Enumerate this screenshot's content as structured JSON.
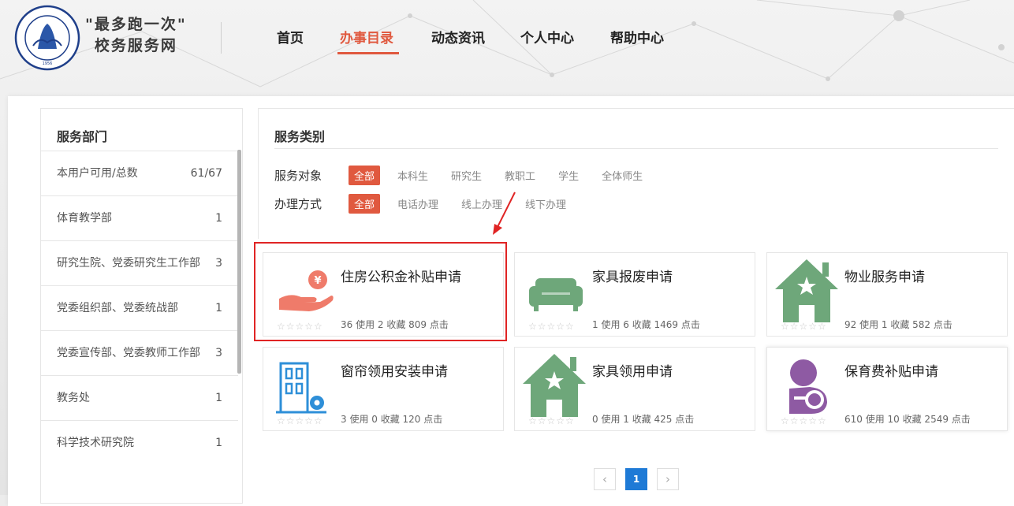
{
  "header": {
    "title_line1": "\"最多跑一次\"",
    "title_line2": "校务服务网",
    "nav": [
      {
        "label": "首页",
        "active": false
      },
      {
        "label": "办事目录",
        "active": true
      },
      {
        "label": "动态资讯",
        "active": false
      },
      {
        "label": "个人中心",
        "active": false
      },
      {
        "label": "帮助中心",
        "active": false
      }
    ]
  },
  "sidebar": {
    "title": "服务部门",
    "items": [
      {
        "label": "本用户可用/总数",
        "count": "61/67"
      },
      {
        "label": "体育教学部",
        "count": "1"
      },
      {
        "label": "研究生院、党委研究生工作部",
        "count": "3"
      },
      {
        "label": "党委组织部、党委统战部",
        "count": "1"
      },
      {
        "label": "党委宣传部、党委教师工作部",
        "count": "3"
      },
      {
        "label": "教务处",
        "count": "1"
      },
      {
        "label": "科学技术研究院",
        "count": "1"
      }
    ]
  },
  "content": {
    "title": "服务类别",
    "filters": {
      "audience_label": "服务对象",
      "audience_options": [
        "全部",
        "本科生",
        "研究生",
        "教职工",
        "学生",
        "全体师生"
      ],
      "method_label": "办理方式",
      "method_options": [
        "全部",
        "电话办理",
        "线上办理",
        "线下办理"
      ]
    },
    "cards": [
      {
        "name": "住房公积金补贴申请",
        "stats": "36 使用 2 收藏 809 点击",
        "icon": "hand-money-icon",
        "color": "#ef7b6a"
      },
      {
        "name": "家具报废申请",
        "stats": "1 使用 6 收藏 1469 点击",
        "icon": "sofa-icon",
        "color": "#6ea77a"
      },
      {
        "name": "物业服务申请",
        "stats": "92 使用 1 收藏 582 点击",
        "icon": "house-star-icon",
        "color": "#6ea77a"
      },
      {
        "name": "窗帘领用安装申请",
        "stats": "3 使用 0 收藏 120 点击",
        "icon": "building-gear-icon",
        "color": "#2e8fd8"
      },
      {
        "name": "家具领用申请",
        "stats": "0 使用 1 收藏 425 点击",
        "icon": "house-star-icon",
        "color": "#6ea77a"
      },
      {
        "name": "保育费补贴申请",
        "stats": "610 使用 10 收藏 2549 点击",
        "icon": "person-child-icon",
        "color": "#8e5aa3"
      }
    ],
    "stars": "☆☆☆☆☆"
  },
  "pagination": {
    "prev": "‹",
    "current": "1",
    "next": "›"
  }
}
